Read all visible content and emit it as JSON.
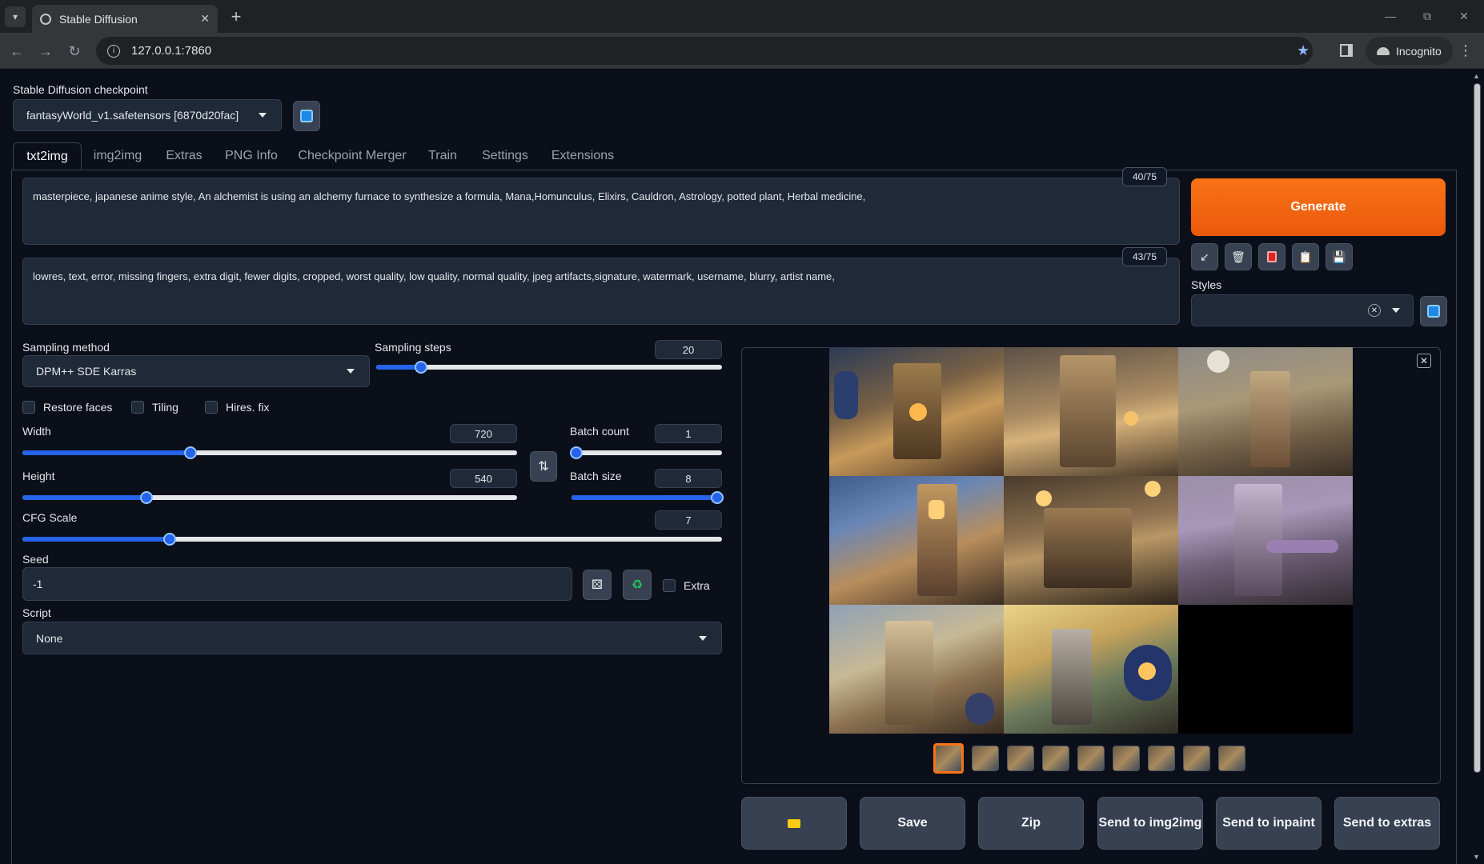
{
  "browser": {
    "tab_title": "Stable Diffusion",
    "url": "127.0.0.1:7860",
    "incognito_label": "Incognito"
  },
  "checkpoint": {
    "label": "Stable Diffusion checkpoint",
    "value": "fantasyWorld_v1.safetensors [6870d20fac]"
  },
  "tabs": [
    "txt2img",
    "img2img",
    "Extras",
    "PNG Info",
    "Checkpoint Merger",
    "Train",
    "Settings",
    "Extensions"
  ],
  "prompt": {
    "positive": "masterpiece, japanese anime style, An alchemist is using an alchemy furnace to synthesize a formula, Mana,Homunculus, Elixirs, Cauldron, Astrology, potted plant, Herbal medicine,",
    "positive_tokens": "40/75",
    "negative": "lowres, text, error, missing fingers, extra digit, fewer digits, cropped, worst quality, low quality, normal quality, jpeg artifacts,signature, watermark, username, blurry, artist name,",
    "negative_tokens": "43/75"
  },
  "generate_label": "Generate",
  "styles_label": "Styles",
  "sampling": {
    "method_label": "Sampling method",
    "method_value": "DPM++ SDE Karras",
    "steps_label": "Sampling steps",
    "steps_value": "20"
  },
  "checkboxes": {
    "restore_faces": "Restore faces",
    "tiling": "Tiling",
    "hires_fix": "Hires. fix",
    "extra": "Extra"
  },
  "size": {
    "width_label": "Width",
    "width_value": "720",
    "height_label": "Height",
    "height_value": "540"
  },
  "batch": {
    "count_label": "Batch count",
    "count_value": "1",
    "size_label": "Batch size",
    "size_value": "8"
  },
  "cfg": {
    "label": "CFG Scale",
    "value": "7"
  },
  "seed": {
    "label": "Seed",
    "value": "-1"
  },
  "script": {
    "label": "Script",
    "value": "None"
  },
  "slider_levels": {
    "sampling_steps": 0.13,
    "width": 0.34,
    "height": 0.25,
    "batch_count": 0.0,
    "batch_size": 1.0,
    "cfg_scale": 0.21
  },
  "actions": {
    "save": "Save",
    "zip": "Zip",
    "send_img2img": "Send to img2img",
    "send_inpaint": "Send to inpaint",
    "send_extras": "Send to extras"
  },
  "colors": {
    "accent_orange": "#f97316",
    "slider_blue": "#2563eb",
    "background": "#0b0f19",
    "panel": "#1f2937"
  }
}
